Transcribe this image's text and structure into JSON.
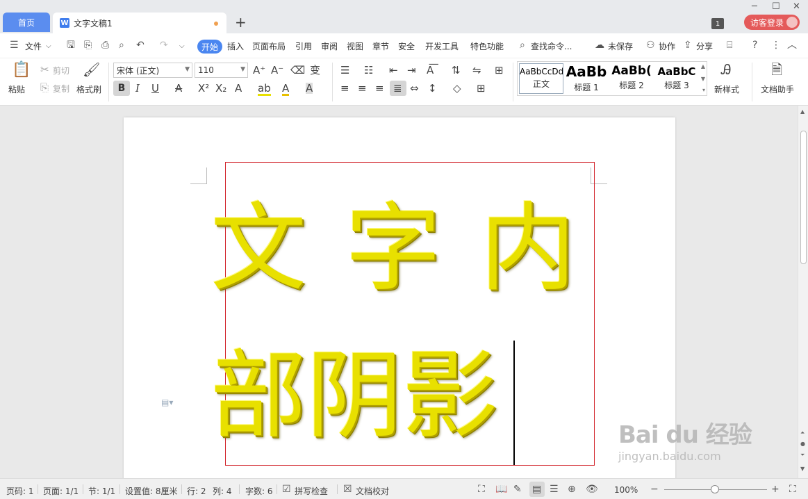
{
  "titlebar": {
    "home_tab": "首页",
    "doc_tab": "文字文稿1",
    "badge": "1",
    "login": "访客登录"
  },
  "menubar": {
    "file": "文件",
    "tabs": [
      "开始",
      "插入",
      "页面布局",
      "引用",
      "审阅",
      "视图",
      "章节",
      "安全",
      "开发工具",
      "特色功能"
    ],
    "search": "查找命令...",
    "unsaved": "未保存",
    "collab": "协作",
    "share": "分享"
  },
  "ribbon": {
    "paste": "粘贴",
    "cut": "剪切",
    "copy": "复制",
    "format_painter": "格式刷",
    "font_name": "宋体 (正文)",
    "font_size": "110",
    "styles": [
      {
        "preview": "AaBbCcDd",
        "name": "正文"
      },
      {
        "preview": "AaBb",
        "name": "标题 1"
      },
      {
        "preview": "AaBb(",
        "name": "标题 2"
      },
      {
        "preview": "AaBbC",
        "name": "标题 3"
      }
    ],
    "new_style": "新样式",
    "doc_helper": "文档助手"
  },
  "document": {
    "line1": "文 字 内",
    "line2": "部阴影",
    "text_color": "#e8e000",
    "box_color": "#d2232a"
  },
  "statusbar": {
    "page_code": "页码: 1",
    "pages": "页面: 1/1",
    "section": "节: 1/1",
    "setting": "设置值: 8厘米",
    "row": "行: 2",
    "col": "列: 4",
    "words": "字数: 6",
    "spell": "拼写检查",
    "proof": "文档校对",
    "zoom": "100%"
  },
  "watermark": {
    "main": "Bai du 经验",
    "sub": "jingyan.baidu.com"
  }
}
